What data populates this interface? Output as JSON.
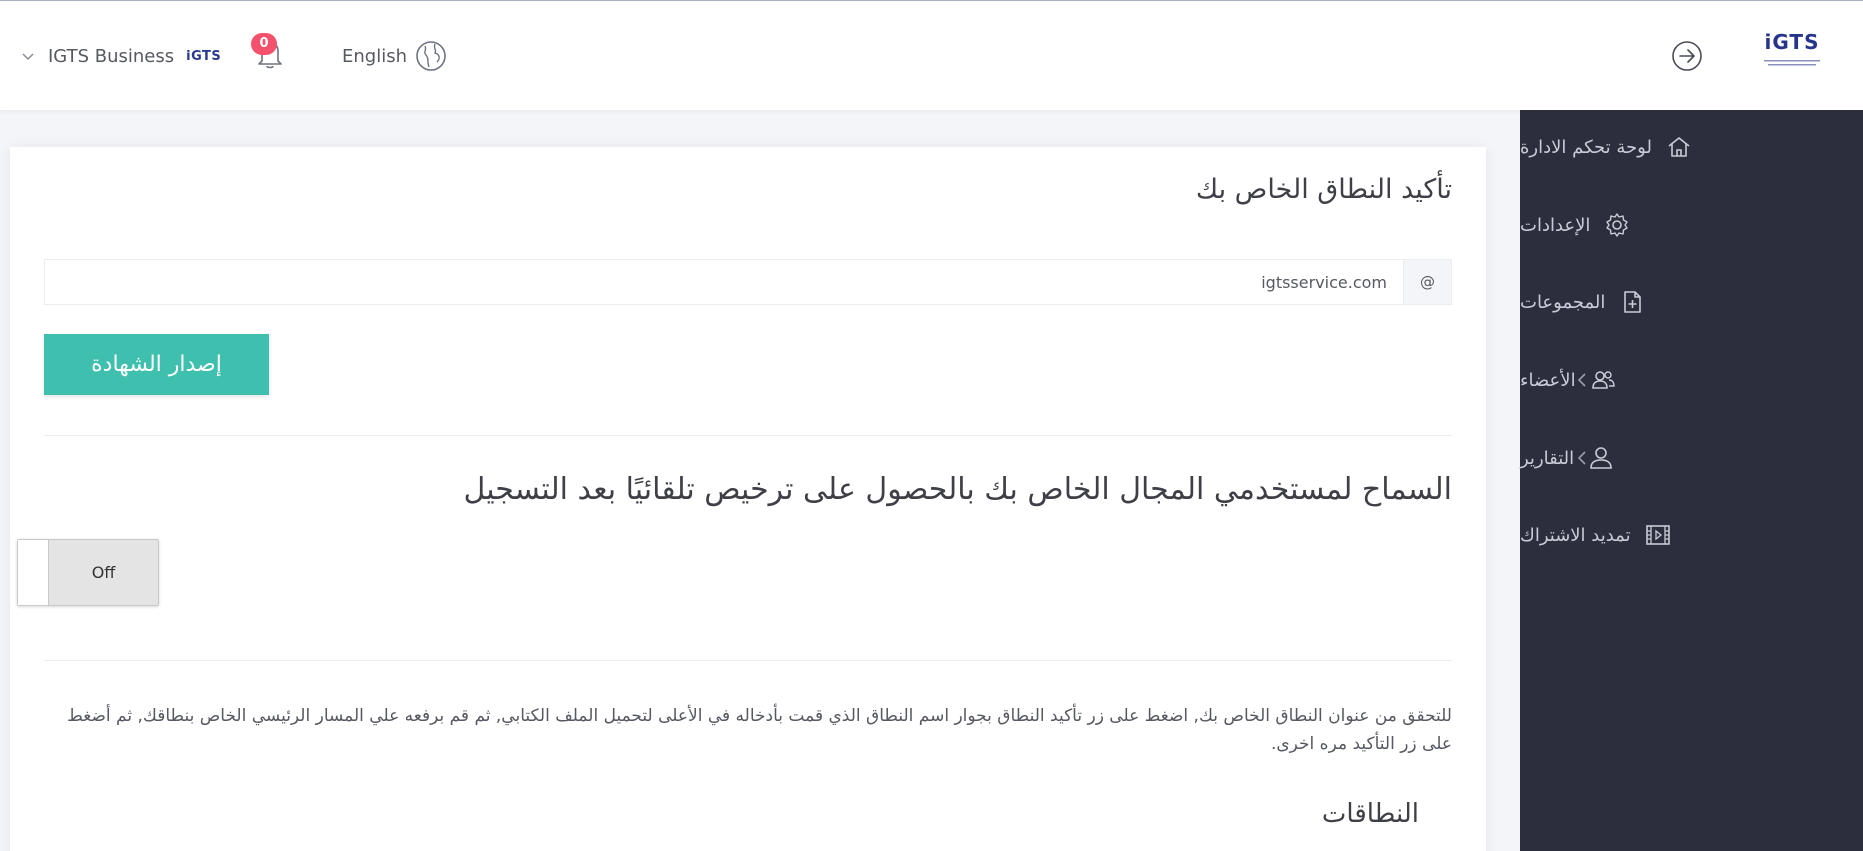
{
  "header": {
    "account_name": "IGTS Business",
    "account_logo_text": "iGTS",
    "notification_count": "0",
    "language_label": "English",
    "brand_text": "iGTS"
  },
  "sidebar": {
    "items": [
      {
        "label": "لوحة تحكم الادارة",
        "icon": "home-icon",
        "has_submenu": false
      },
      {
        "label": "الإعدادات",
        "icon": "gear-icon",
        "has_submenu": false
      },
      {
        "label": "المجموعات",
        "icon": "file-plus-icon",
        "has_submenu": false
      },
      {
        "label": "الأعضاء",
        "icon": "users-icon",
        "has_submenu": true
      },
      {
        "label": "التقارير",
        "icon": "user-icon",
        "has_submenu": true
      },
      {
        "label": "تمديد الاشتراك",
        "icon": "film-icon",
        "has_submenu": false
      }
    ]
  },
  "main": {
    "title": "تأكيد النطاق الخاص بك",
    "domain_prefix": "@",
    "domain_value": "igtsservice.com",
    "issue_button_label": "إصدار الشهادة",
    "auto_license_title": "السماح لمستخدمي المجال الخاص بك بالحصول على ترخيص تلقائيًا بعد التسجيل",
    "toggle_state": "Off",
    "help_text": "للتحقق من عنوان النطاق الخاص بك, اضغط على زر تأكيد النطاق بجوار اسم النطاق الذي قمت بأدخاله في الأعلى لتحميل الملف الكتابي, ثم قم برفعه علي المسار الرئيسي الخاص بنطاقك, ثم أضغط على زر التأكيد مره اخرى.",
    "domains_title": "النطاقات"
  },
  "colors": {
    "sidebar_bg": "#2c2e3e",
    "accent_button": "#3fbfad",
    "badge": "#f4516c",
    "brand": "#27348b"
  }
}
